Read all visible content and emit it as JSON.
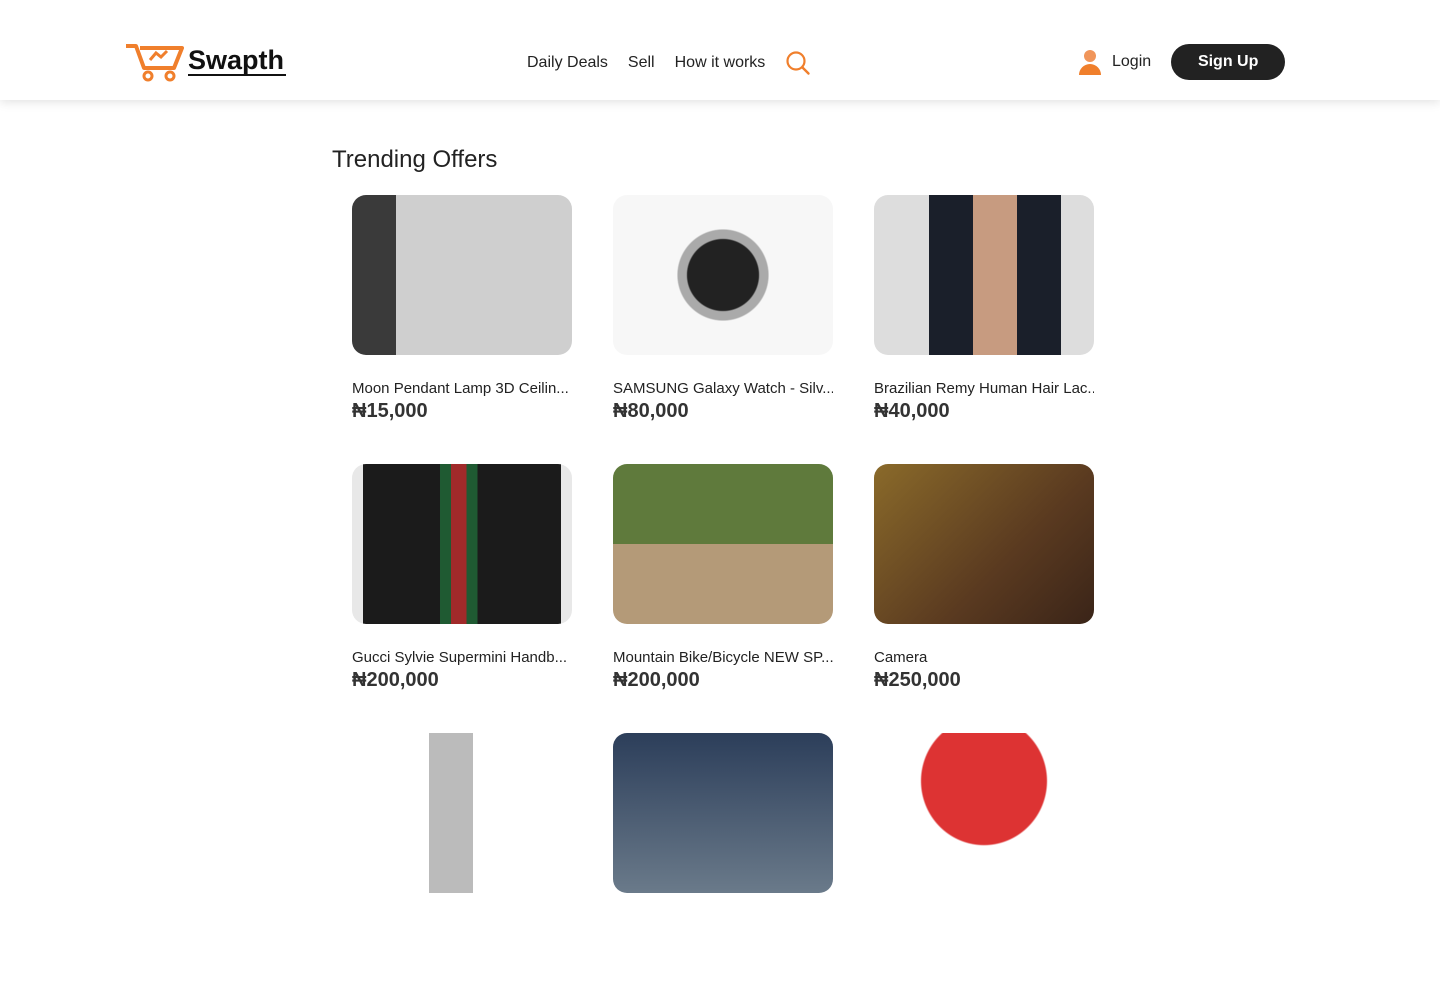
{
  "header": {
    "logo_text": "Swapth",
    "nav": [
      "Daily Deals",
      "Sell",
      "How it works"
    ],
    "login": "Login",
    "signup": "Sign Up",
    "accent": "#f07f2c"
  },
  "main": {
    "title": "Trending Offers",
    "products": [
      {
        "name": "Moon Pendant Lamp 3D Ceilin...",
        "price": "₦15,000",
        "bg": "linear-gradient(90deg,#3a3a3a 0 20%,#cfcfcf 20% 100%)"
      },
      {
        "name": "SAMSUNG Galaxy Watch - Silv...",
        "price": "₦80,000",
        "bg": "radial-gradient(circle at 50% 50%,#222 0 26%,#aaa 27% 33%,#f7f7f7 34%)"
      },
      {
        "name": "Brazilian Remy Human Hair Lac...",
        "price": "₦40,000",
        "bg": "linear-gradient(90deg,#ddd 0 25%,#1a1f2a 25% 45%,#c79b80 45% 65%,#1a1f2a 65% 85%,#ddd 85%)"
      },
      {
        "name": "Gucci Sylvie Supermini Handb...",
        "price": "₦200,000",
        "bg": "linear-gradient(90deg,#e8e8e8 0 5%,#1b1b1b 5% 40%,#1f5a32 40% 45%,#a12a2a 45% 52%,#1f5a32 52% 57%,#1b1b1b 57% 95%,#e8e8e8 95%)"
      },
      {
        "name": "Mountain Bike/Bicycle NEW SP...",
        "price": "₦200,000",
        "bg": "linear-gradient(180deg,#5f7a3c 0 50%,#b49a78 50%)"
      },
      {
        "name": "Camera",
        "price": "₦250,000",
        "bg": "linear-gradient(135deg,#8a6a2a,#5a3a20 60%,#3a2418)"
      },
      {
        "name": "",
        "price": "",
        "bg": "linear-gradient(90deg,#fff 0 35%,#bbb 35% 55%,#fff 55%)"
      },
      {
        "name": "",
        "price": "",
        "bg": "linear-gradient(180deg,#2c3e5a,#6a7a8a)"
      },
      {
        "name": "",
        "price": "",
        "bg": "radial-gradient(ellipse at 50% 30%,#d33 0 40%,#fff 41%)"
      }
    ]
  }
}
